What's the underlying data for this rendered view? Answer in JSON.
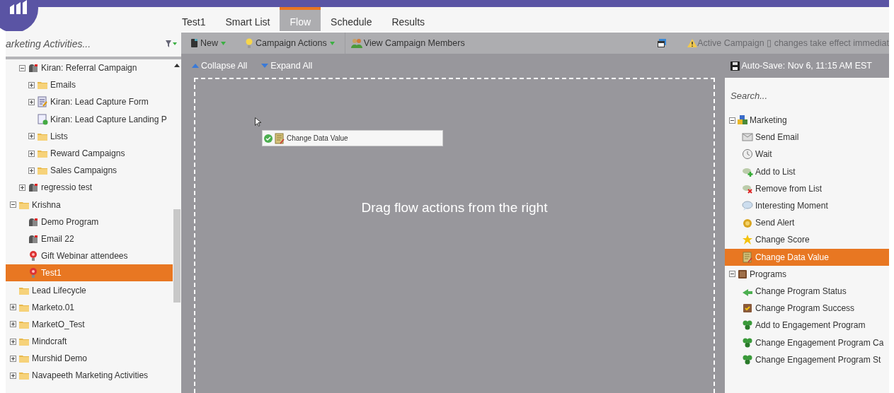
{
  "tabs": [
    {
      "label": "Test1",
      "selected": false
    },
    {
      "label": "Smart List",
      "selected": false
    },
    {
      "label": "Flow",
      "selected": true
    },
    {
      "label": "Schedule",
      "selected": false
    },
    {
      "label": "Results",
      "selected": false
    }
  ],
  "sidebar": {
    "search": {
      "placeholder": "arketing Activities..."
    },
    "tree": {
      "continued_children": [
        {
          "label": "Kiran: Referral Campaign",
          "kind": "program",
          "expanded": true,
          "selected": false,
          "children": [
            {
              "label": "Emails",
              "kind": "folder",
              "expanded": false,
              "selected": false
            },
            {
              "label": "Kiran: Lead Capture Form",
              "kind": "form",
              "expanded": false,
              "selected": false
            },
            {
              "label": "Kiran: Lead Capture Landing P",
              "kind": "landing-page",
              "selected": false
            },
            {
              "label": "Lists",
              "kind": "folder",
              "expanded": false,
              "selected": false
            },
            {
              "label": "Reward Campaigns",
              "kind": "folder",
              "expanded": false,
              "selected": false
            },
            {
              "label": "Sales Campaigns",
              "kind": "folder",
              "expanded": false,
              "selected": false
            }
          ]
        },
        {
          "label": "regressio test",
          "kind": "program",
          "expanded": false,
          "selected": false
        }
      ],
      "items": [
        {
          "label": "Krishna",
          "kind": "folder",
          "expanded": true,
          "selected": false,
          "children": [
            {
              "label": "Demo Program",
              "kind": "program",
              "selected": false
            },
            {
              "label": "Email 22",
              "kind": "program",
              "selected": false
            },
            {
              "label": "Gift Webinar attendees",
              "kind": "campaign",
              "selected": false
            },
            {
              "label": "Test1",
              "kind": "campaign",
              "selected": true
            }
          ]
        },
        {
          "label": "Lead Lifecycle",
          "kind": "folder",
          "selected": false
        },
        {
          "label": "Marketo.01",
          "kind": "folder",
          "expanded": false,
          "selected": false
        },
        {
          "label": "MarketO_Test",
          "kind": "folder",
          "expanded": false,
          "selected": false
        },
        {
          "label": "Mindcraft",
          "kind": "folder",
          "expanded": false,
          "selected": false
        },
        {
          "label": "Murshid Demo",
          "kind": "folder",
          "expanded": false,
          "selected": false
        },
        {
          "label": "Navapeeth Marketing Activities",
          "kind": "folder",
          "expanded": false,
          "selected": false
        }
      ]
    }
  },
  "toolbar": {
    "new": "New",
    "campaign_actions": "Campaign Actions",
    "view_members": "View Campaign Members",
    "warning": "Active Campaign ▯ changes take effect immediat"
  },
  "subbar": {
    "collapse_all": "Collapse All",
    "expand_all": "Expand All",
    "autosave": "Auto-Save: Nov 6, 11:15 AM EST"
  },
  "canvas": {
    "steps": [
      {
        "label": "Change Data Value"
      }
    ],
    "hint": "Drag flow actions from the right"
  },
  "actions_panel": {
    "search": {
      "placeholder": "Search..."
    },
    "groups": [
      {
        "label": "Marketing",
        "kind": "marketing",
        "expanded": true,
        "items": [
          {
            "label": "Send Email",
            "kind": "email",
            "selected": false
          },
          {
            "label": "Wait",
            "kind": "clock",
            "selected": false
          },
          {
            "label": "Add to List",
            "kind": "add-list",
            "selected": false
          },
          {
            "label": "Remove from List",
            "kind": "remove-list",
            "selected": false
          },
          {
            "label": "Interesting Moment",
            "kind": "speech",
            "selected": false
          },
          {
            "label": "Send Alert",
            "kind": "bell",
            "selected": false
          },
          {
            "label": "Change Score",
            "kind": "star",
            "selected": false
          },
          {
            "label": "Change Data Value",
            "kind": "data",
            "selected": true
          }
        ]
      },
      {
        "label": "Programs",
        "kind": "programs",
        "expanded": true,
        "items": [
          {
            "label": "Change Program Status",
            "kind": "status",
            "selected": false
          },
          {
            "label": "Change Program Success",
            "kind": "success",
            "selected": false
          },
          {
            "label": "Add to Engagement Program",
            "kind": "engagement",
            "selected": false
          },
          {
            "label": "Change Engagement Program Ca",
            "kind": "engagement",
            "selected": false
          },
          {
            "label": "Change Engagement Program St",
            "kind": "engagement",
            "selected": false
          }
        ]
      }
    ]
  }
}
